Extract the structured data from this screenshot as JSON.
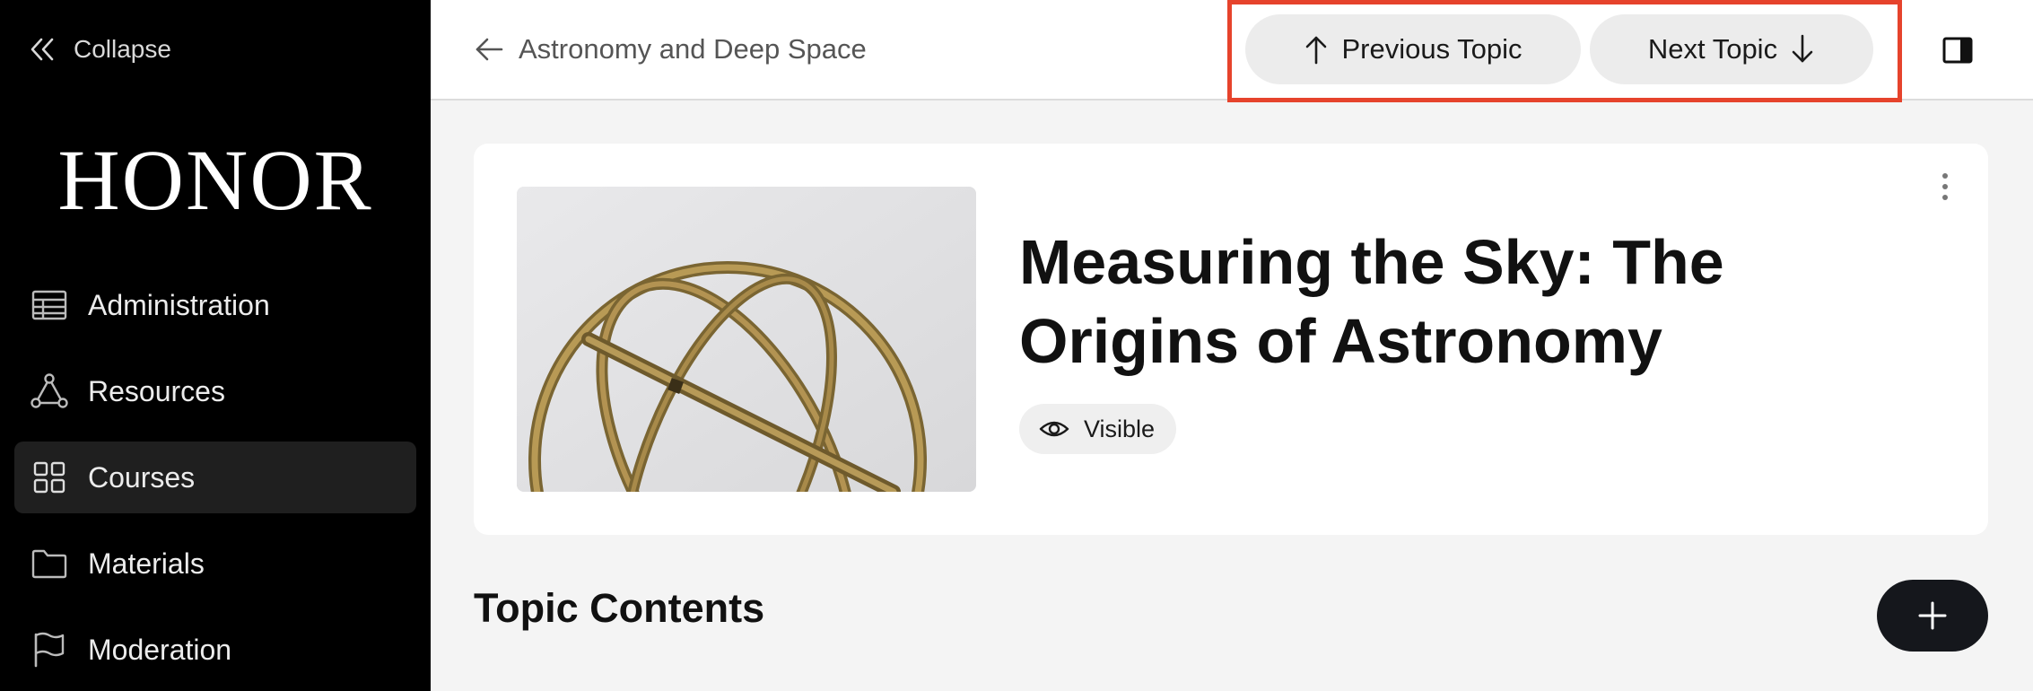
{
  "sidebar": {
    "collapse_label": "Collapse",
    "logo": "HONOR",
    "items": [
      {
        "label": "Administration",
        "icon": "table-icon",
        "active": false
      },
      {
        "label": "Resources",
        "icon": "network-icon",
        "active": false
      },
      {
        "label": "Courses",
        "icon": "grid-icon",
        "active": true
      },
      {
        "label": "Materials",
        "icon": "folder-icon",
        "active": false
      },
      {
        "label": "Moderation",
        "icon": "flag-icon",
        "active": false
      }
    ]
  },
  "topbar": {
    "back_label": "Astronomy and Deep Space",
    "prev_label": "Previous Topic",
    "next_label": "Next Topic",
    "highlight_color": "#e6432c"
  },
  "topic": {
    "title": "Measuring the Sky: The Origins of Astronomy",
    "visibility": "Visible",
    "image": "armillary-sphere-photo"
  },
  "contents": {
    "heading": "Topic Contents",
    "add_icon": "plus-icon"
  }
}
